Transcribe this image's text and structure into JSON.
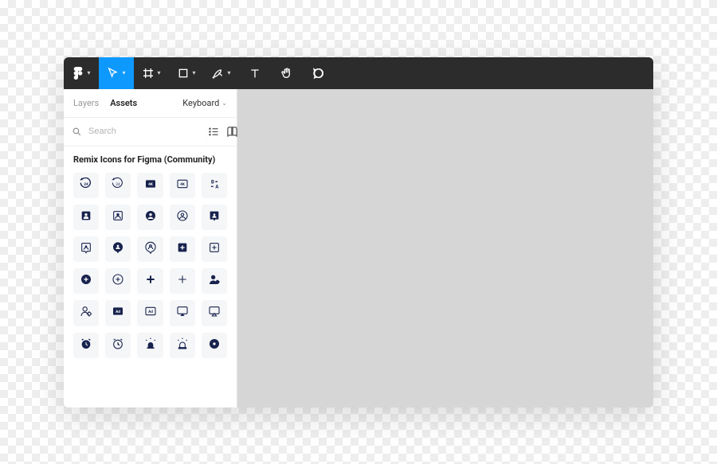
{
  "toolbar": {
    "tools": [
      {
        "name": "figma-menu",
        "hasChevron": true
      },
      {
        "name": "move-tool",
        "hasChevron": true,
        "active": true
      },
      {
        "name": "frame-tool",
        "hasChevron": true
      },
      {
        "name": "shape-tool",
        "hasChevron": true
      },
      {
        "name": "pen-tool",
        "hasChevron": true
      },
      {
        "name": "text-tool",
        "hasChevron": false
      },
      {
        "name": "hand-tool",
        "hasChevron": false
      },
      {
        "name": "comment-tool",
        "hasChevron": false
      }
    ]
  },
  "sidebar": {
    "tabs": {
      "layers": "Layers",
      "assets": "Assets",
      "activeTab": "assets"
    },
    "page": {
      "label": "Keyboard"
    },
    "search": {
      "placeholder": "Search"
    },
    "library": {
      "title": "Remix Icons for Figma (Community)",
      "icons": [
        "24-hours-fill",
        "24-hours-line",
        "4k-fill",
        "4k-line",
        "a-b",
        "account-box-fill",
        "account-box-line",
        "account-circle-fill",
        "account-circle-line",
        "account-pin-box-fill",
        "account-pin-box-line",
        "account-pin-circle-fill",
        "account-pin-circle-line",
        "add-box-fill",
        "add-box-line",
        "add-circle-fill",
        "add-circle-line",
        "add-fill",
        "add-line",
        "admin-fill",
        "admin-line",
        "advertisement-fill",
        "advertisement-line",
        "airplay-fill",
        "airplay-line",
        "alarm-fill",
        "alarm-line",
        "alarm-warning-fill",
        "alarm-warning-line",
        "album-fill"
      ]
    }
  }
}
